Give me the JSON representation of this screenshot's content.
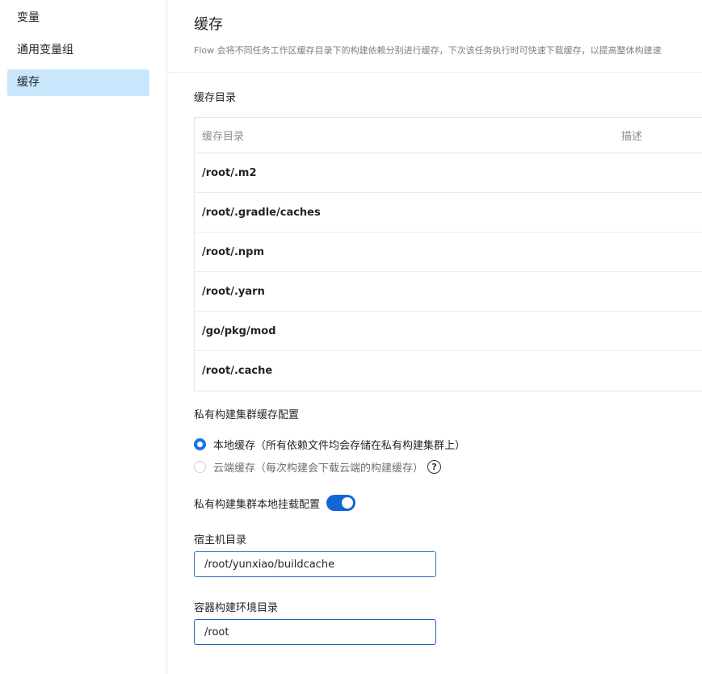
{
  "sidebar": {
    "items": [
      {
        "label": "变量",
        "active": false
      },
      {
        "label": "通用变量组",
        "active": false
      },
      {
        "label": "缓存",
        "active": true
      }
    ]
  },
  "header": {
    "title": "缓存",
    "description": "Flow 会将不同任务工作区缓存目录下的构建依赖分别进行缓存，下次该任务执行时可快速下载缓存，以提高整体构建速"
  },
  "cache_dirs": {
    "section_title": "缓存目录",
    "columns": [
      "缓存目录",
      "描述"
    ],
    "rows": [
      "/root/.m2",
      "/root/.gradle/caches",
      "/root/.npm",
      "/root/.yarn",
      "/go/pkg/mod",
      "/root/.cache"
    ]
  },
  "private_cache": {
    "section_title": "私有构建集群缓存配置",
    "options": [
      {
        "label": "本地缓存（所有依赖文件均会存储在私有构建集群上）",
        "checked": true
      },
      {
        "label": "云端缓存（每次构建会下载云端的构建缓存）",
        "checked": false
      }
    ],
    "help_glyph": "?"
  },
  "mount": {
    "label": "私有构建集群本地挂载配置",
    "enabled": true,
    "host_dir_label": "宿主机目录",
    "host_dir_value": "/root/yunxiao/buildcache",
    "container_dir_label": "容器构建环境目录",
    "container_dir_value": "/root"
  },
  "colors": {
    "accent": "#1a73e8",
    "active_bg": "#c9e6fc"
  }
}
